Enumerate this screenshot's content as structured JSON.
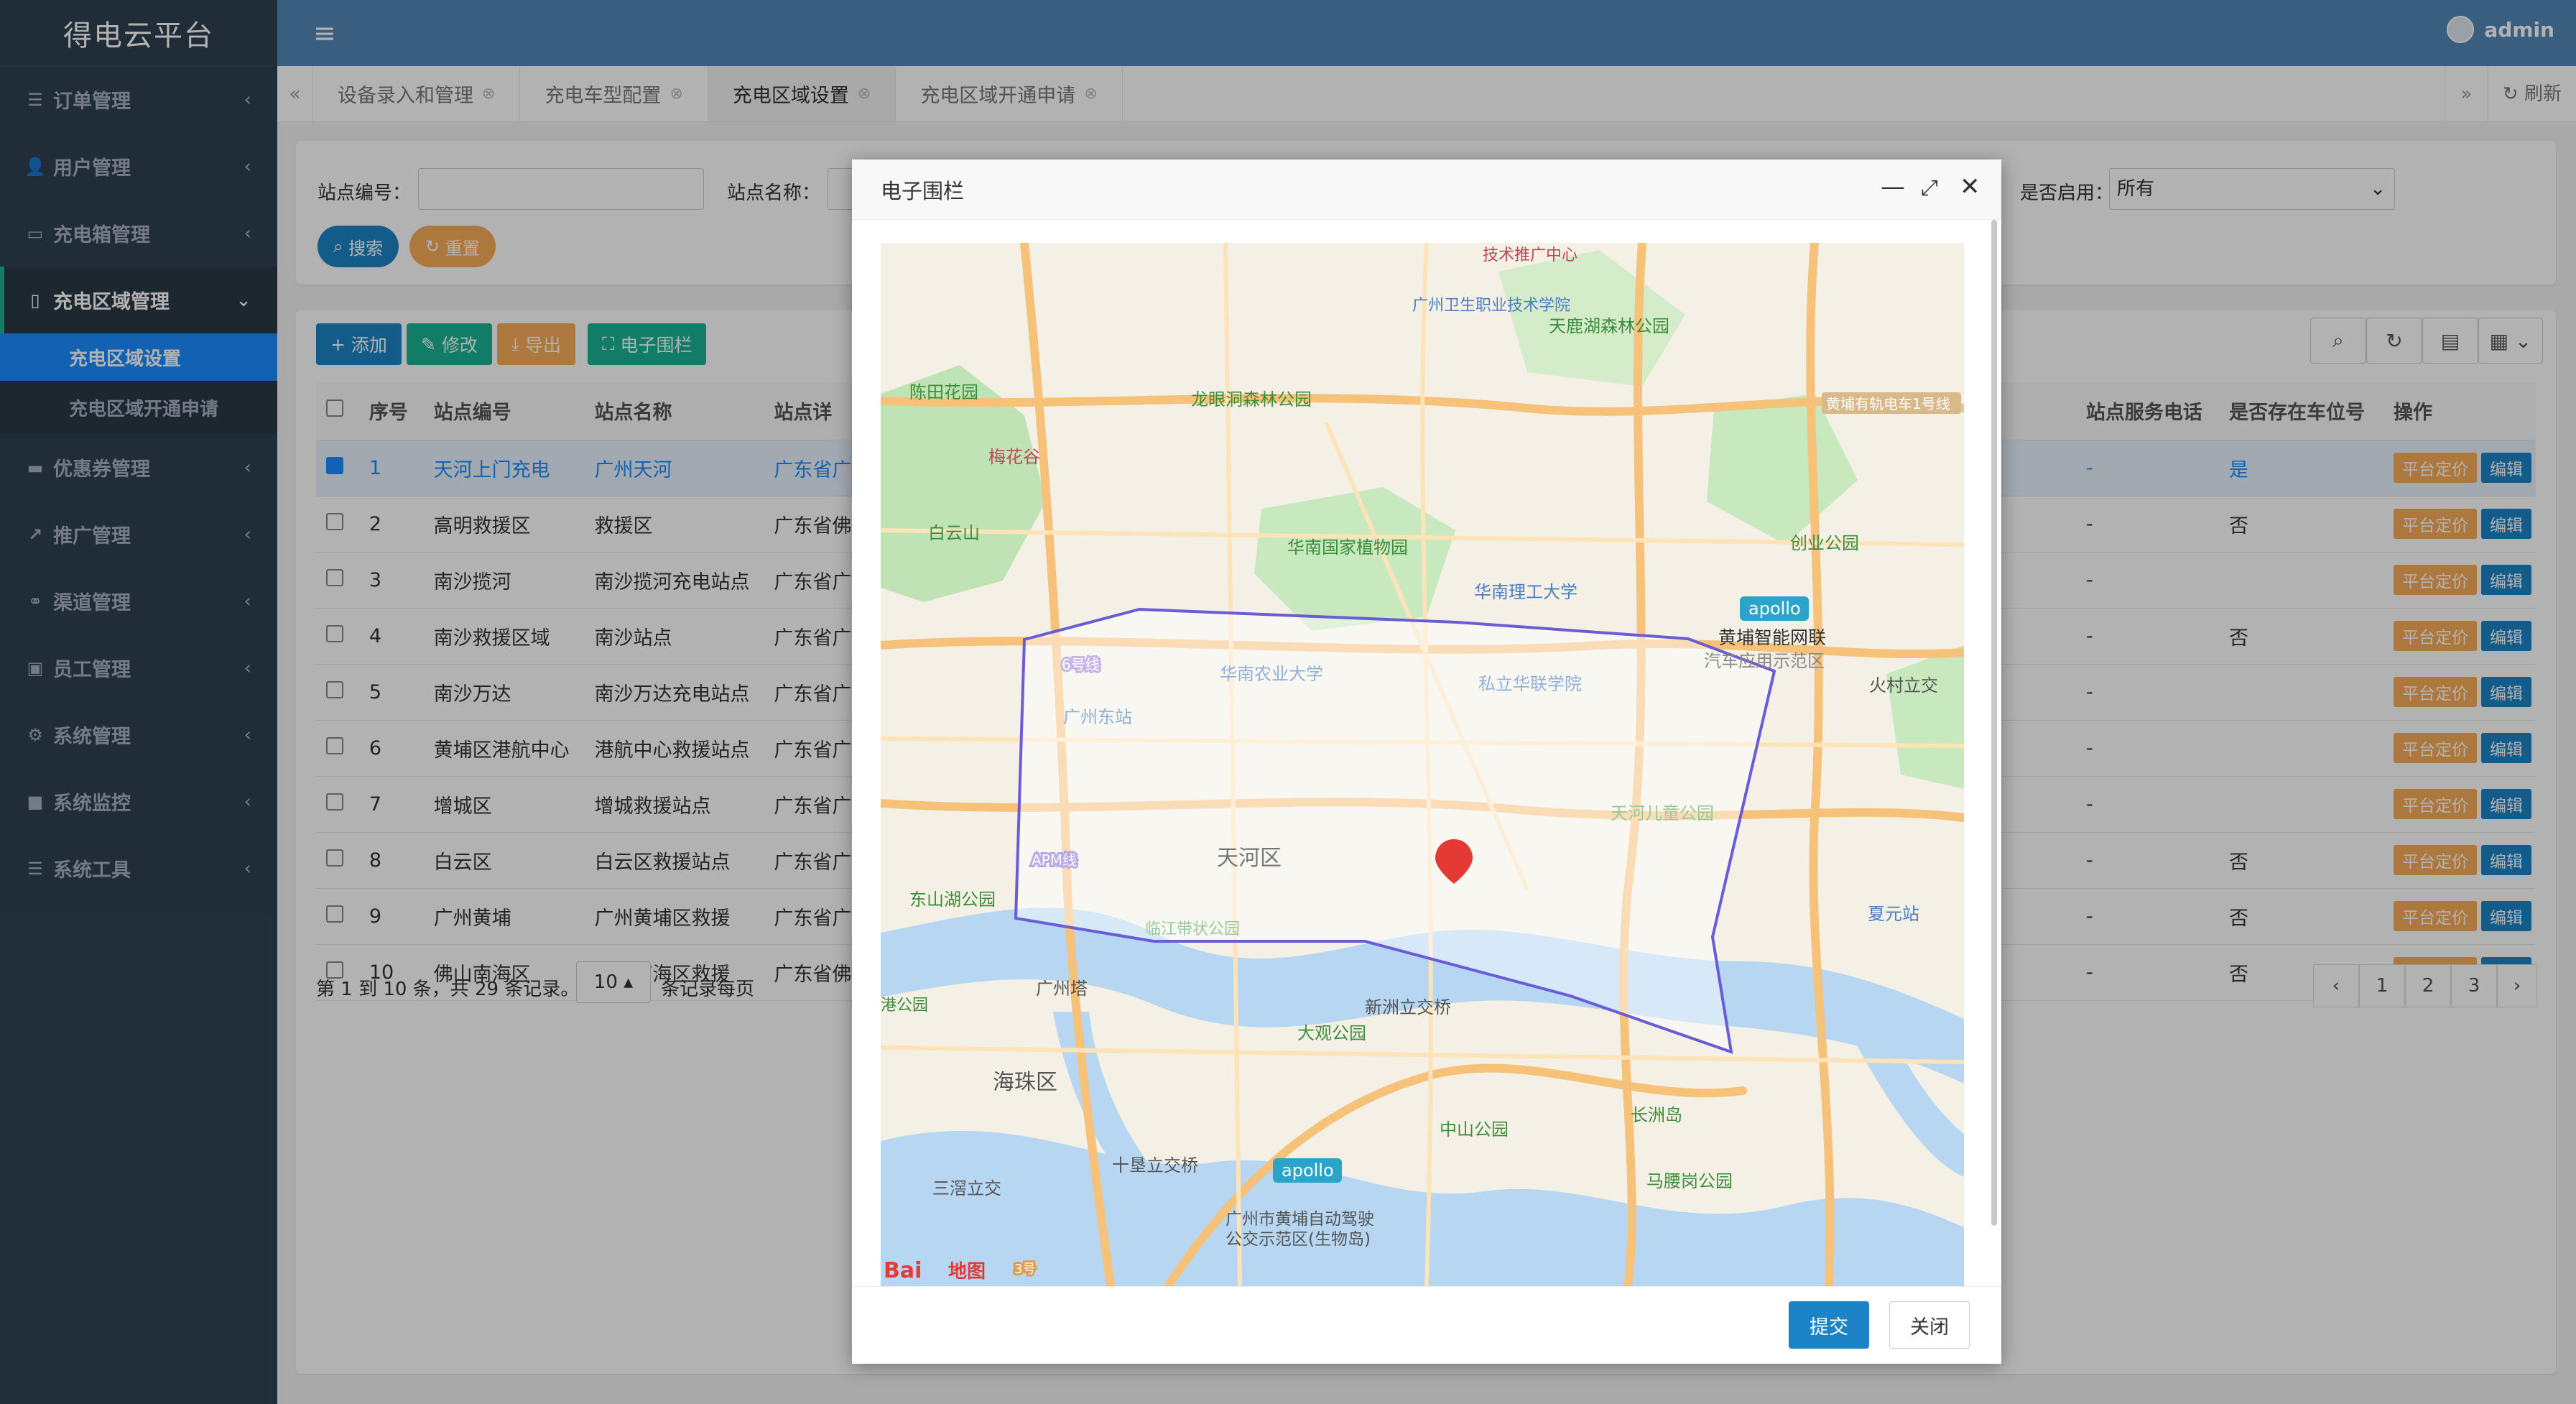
{
  "app": {
    "title": "得电云平台",
    "user": "admin"
  },
  "sidebar": {
    "items": [
      {
        "label": "订单管理",
        "icon": "list-icon"
      },
      {
        "label": "用户管理",
        "icon": "user-icon"
      },
      {
        "label": "充电箱管理",
        "icon": "battery-icon"
      },
      {
        "label": "充电区域管理",
        "icon": "map-icon",
        "open": true,
        "children": [
          {
            "label": "充电区域设置",
            "active": true
          },
          {
            "label": "充电区域开通申请"
          }
        ]
      },
      {
        "label": "优惠券管理",
        "icon": "card-icon"
      },
      {
        "label": "推广管理",
        "icon": "share-icon"
      },
      {
        "label": "渠道管理",
        "icon": "handshake-icon"
      },
      {
        "label": "员工管理",
        "icon": "id-card-icon"
      },
      {
        "label": "系统管理",
        "icon": "gear-icon"
      },
      {
        "label": "系统监控",
        "icon": "video-icon"
      },
      {
        "label": "系统工具",
        "icon": "list-icon"
      }
    ]
  },
  "tabs": {
    "items": [
      {
        "label": "设备录入和管理"
      },
      {
        "label": "充电车型配置"
      },
      {
        "label": "充电区域设置",
        "active": true
      },
      {
        "label": "充电区域开通申请"
      }
    ],
    "refresh": "刷新"
  },
  "search": {
    "station_code_label": "站点编号：",
    "station_name_label": "站点名称：",
    "enabled_label": "是否启用：",
    "enabled_value": "所有",
    "search_button": "搜索",
    "reset_button": "重置"
  },
  "toolbar": {
    "add": "添加",
    "edit": "修改",
    "export": "导出",
    "fence": "电子围栏"
  },
  "table": {
    "columns": [
      "序号",
      "站点编号",
      "站点名称",
      "站点详",
      "站点服务电话",
      "是否存在车位号",
      "操作"
    ],
    "rows": [
      {
        "no": "1",
        "code": "天河上门充电",
        "name": "广州天河",
        "addr": "广东省广",
        "phone": "-",
        "slot": "是"
      },
      {
        "no": "2",
        "code": "高明救援区",
        "name": "救援区",
        "addr": "广东省佛",
        "phone": "-",
        "slot": "否"
      },
      {
        "no": "3",
        "code": "南沙揽河",
        "name": "南沙揽河充电站点",
        "addr": "广东省广",
        "phone": "-",
        "slot": ""
      },
      {
        "no": "4",
        "code": "南沙救援区域",
        "name": "南沙站点",
        "addr": "广东省广",
        "phone": "-",
        "slot": "否"
      },
      {
        "no": "5",
        "code": "南沙万达",
        "name": "南沙万达充电站点",
        "addr": "广东省广",
        "phone": "-",
        "slot": ""
      },
      {
        "no": "6",
        "code": "黄埔区港航中心",
        "name": "港航中心救援站点",
        "addr": "广东省广",
        "phone": "-",
        "slot": ""
      },
      {
        "no": "7",
        "code": "增城区",
        "name": "增城救援站点",
        "addr": "广东省广",
        "phone": "-",
        "slot": ""
      },
      {
        "no": "8",
        "code": "白云区",
        "name": "白云区救援站点",
        "addr": "广东省广",
        "phone": "-",
        "slot": "否"
      },
      {
        "no": "9",
        "code": "广州黄埔",
        "name": "广州黄埔区救援",
        "addr": "广东省广",
        "phone": "-",
        "slot": "否"
      },
      {
        "no": "10",
        "code": "佛山南海区",
        "name": "佛山南海区救援",
        "addr": "广东省佛",
        "phone": "-",
        "slot": "否"
      }
    ],
    "op_price": "平台定价",
    "op_edit": "编辑"
  },
  "pagination": {
    "summary": "第 1 到 10 条，共 29 条记录。",
    "page_size": "10",
    "page_size_suffix": "条记录每页",
    "pages": [
      "1",
      "2",
      "3"
    ],
    "prev": "‹",
    "next": "›"
  },
  "modal": {
    "title": "电子围栏",
    "submit": "提交",
    "close": "关闭",
    "map_labels": {
      "tianhe": "天河区",
      "haizhu": "海珠区",
      "canton_tower": "广州塔",
      "huangpu_ai": "黄埔智能网联",
      "huangpu_ai2": "汽车应用示范区",
      "huocun": "火村立交",
      "xinzhou": "新洲立交桥",
      "shiba": "十垦立交桥",
      "sanjiao": "三滘立交",
      "dongshanhu": "东山湖公园",
      "daguan": "大观公园",
      "zhongshan": "中山公园",
      "changzhou": "长洲岛",
      "masuigang": "马腰岗公园",
      "baiyunshan": "白云山",
      "meihuagu": "梅花谷",
      "chenhuayuan": "陈田花园",
      "longyan": "龙眼洞森林公园",
      "tianlu": "天鹿湖森林公园",
      "huanan_botanic": "华南国家植物园",
      "huanan_tech": "华南理工大学",
      "huanan_agri": "华南农业大学",
      "zhongkai": "私立华联学院",
      "guangzhou_east": "广州东站",
      "tianhe_children": "天河儿童公园",
      "health_college": "广州卫生职业技术学院",
      "tech_center": "技术推广中心",
      "chuangye": "创业公园",
      "huangpu_tram": "黄埔有轨电车1号线",
      "xiayuan": "夏元站",
      "apollo": "apollo",
      "apollo2": "apollo",
      "demo_zone": "广州市黄埔自动驾驶",
      "demo_zone2": "公交示范区(生物岛)",
      "baidu": "Bai",
      "baidu2": "地图",
      "line3": "3号",
      "apm": "APM线",
      "line6": "6号线",
      "linjiang": "临江带状公园",
      "gang": "港公园"
    }
  }
}
